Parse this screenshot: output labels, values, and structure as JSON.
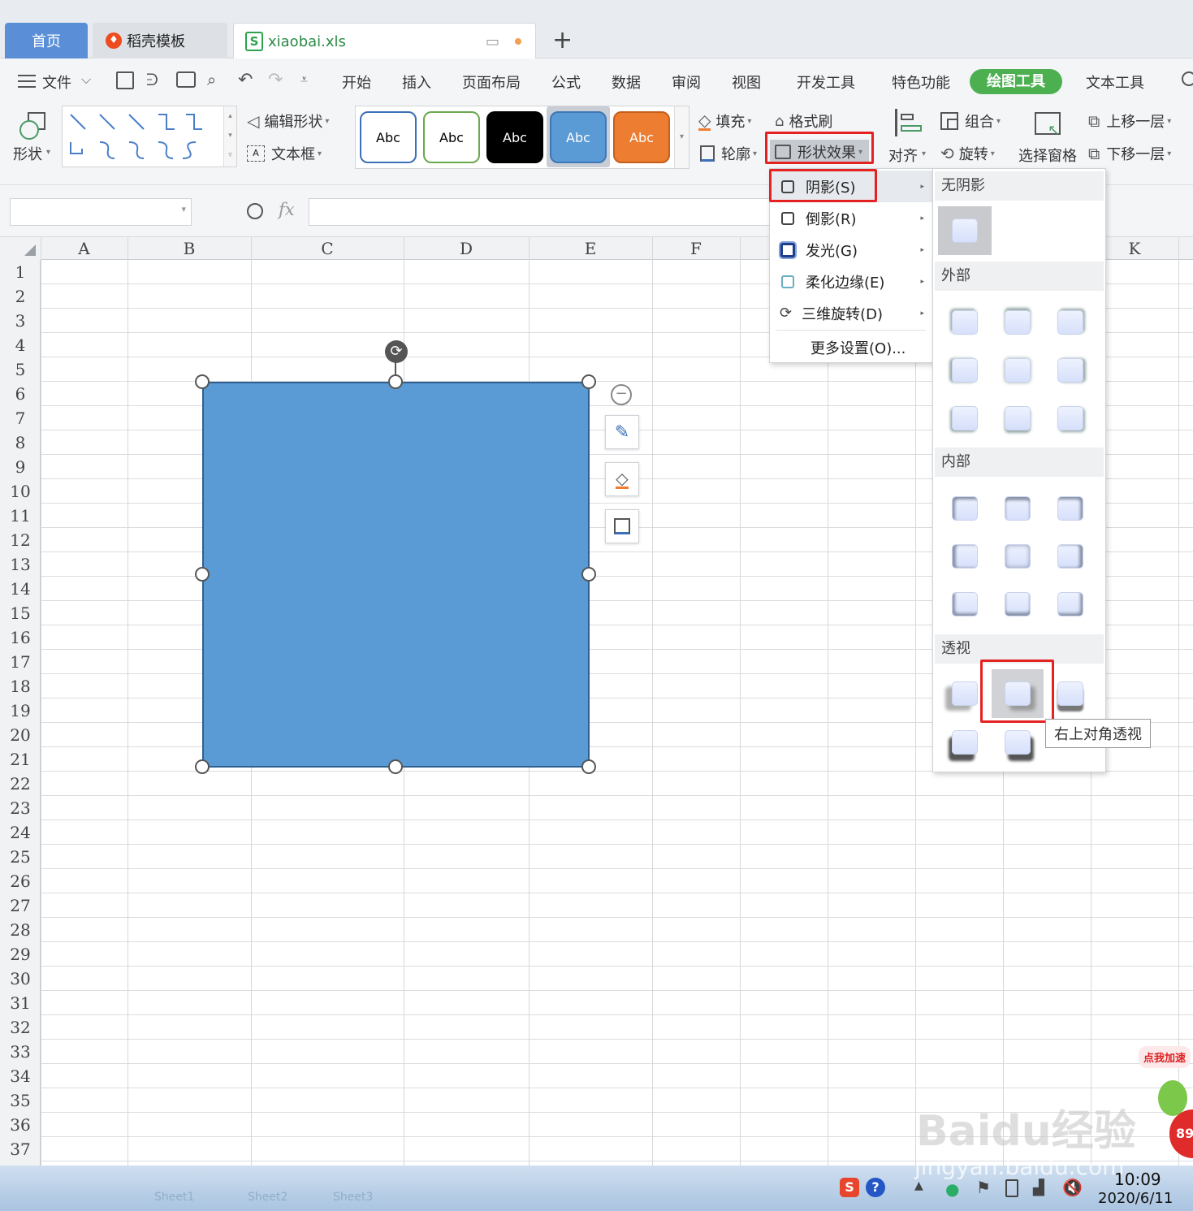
{
  "tabs": {
    "home": "首页",
    "template": "稻壳模板",
    "file": "xiaobai.xls",
    "new": "+"
  },
  "menu": {
    "file": "文件",
    "items": [
      "开始",
      "插入",
      "页面布局",
      "公式",
      "数据",
      "审阅",
      "视图",
      "开发工具",
      "特色功能",
      "绘图工具",
      "文本工具"
    ],
    "active": "绘图工具"
  },
  "ribbon": {
    "shape": "形状",
    "edit_shape": "编辑形状",
    "textbox": "文本框",
    "style_label": "Abc",
    "fill": "填充",
    "format_painter": "格式刷",
    "outline": "轮廓",
    "shape_effect": "形状效果",
    "align": "对齐",
    "group": "组合",
    "rotate": "旋转",
    "selection_pane": "选择窗格",
    "bring_forward": "上移一层",
    "send_backward": "下移一层"
  },
  "formula_bar": {
    "fx": "fx",
    "name_box": "",
    "content": ""
  },
  "columns": [
    "A",
    "B",
    "C",
    "D",
    "E",
    "F",
    "K"
  ],
  "rows": [
    "1",
    "2",
    "3",
    "4",
    "5",
    "6",
    "7",
    "8",
    "9",
    "10",
    "11",
    "12",
    "13",
    "14",
    "15",
    "16",
    "17",
    "18",
    "19",
    "20",
    "21",
    "22",
    "23",
    "24",
    "25",
    "26",
    "27",
    "28",
    "29",
    "30",
    "31",
    "32",
    "33",
    "34",
    "35",
    "36",
    "37"
  ],
  "dropdown": {
    "shadow": "阴影(S)",
    "reflection": "倒影(R)",
    "glow": "发光(G)",
    "soft_edges": "柔化边缘(E)",
    "rotation_3d": "三维旋转(D)",
    "more": "更多设置(O)..."
  },
  "submenu": {
    "no_shadow": "无阴影",
    "outer": "外部",
    "inner": "内部",
    "perspective": "透视",
    "tooltip": "右上对角透视"
  },
  "taskbar": {
    "time": "10:09",
    "date": "2020/6/11",
    "sheets": [
      "Sheet1",
      "Sheet2",
      "Sheet3"
    ]
  },
  "watermark": {
    "brand": "Baidu经验",
    "url": "jingyan.baidu.com",
    "speed_badge": "点我加速",
    "speed_value": "89"
  },
  "colors": {
    "shape_fill": "#5b9bd5",
    "active_tab": "#4caf50",
    "highlight": "#e52222"
  }
}
